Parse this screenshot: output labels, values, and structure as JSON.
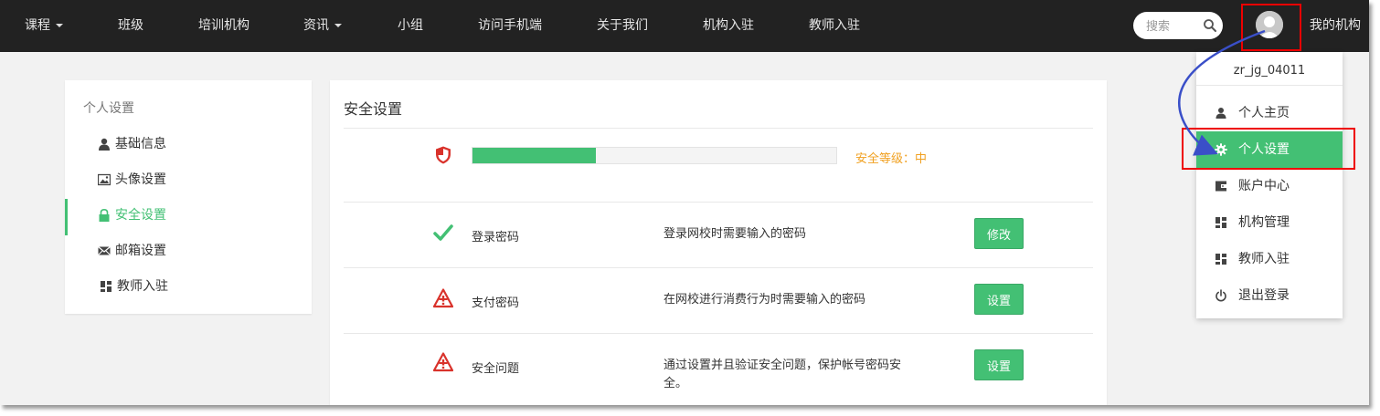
{
  "nav": {
    "items": [
      {
        "label": "课程",
        "dropdown": true
      },
      {
        "label": "班级",
        "dropdown": false
      },
      {
        "label": "培训机构",
        "dropdown": false
      },
      {
        "label": "资讯",
        "dropdown": true
      },
      {
        "label": "小组",
        "dropdown": false
      },
      {
        "label": "访问手机端",
        "dropdown": false
      },
      {
        "label": "关于我们",
        "dropdown": false
      },
      {
        "label": "机构入驻",
        "dropdown": false
      },
      {
        "label": "教师入驻",
        "dropdown": false
      }
    ],
    "search_placeholder": "搜索",
    "my_org": "我的机构",
    "bg_color": "#222222"
  },
  "sidebar": {
    "title": "个人设置",
    "items": [
      {
        "label": "基础信息",
        "icon": "user-icon",
        "active": false
      },
      {
        "label": "头像设置",
        "icon": "image-icon",
        "active": false
      },
      {
        "label": "安全设置",
        "icon": "lock-icon",
        "active": true
      },
      {
        "label": "邮箱设置",
        "icon": "envelope-icon",
        "active": false
      },
      {
        "label": "教师入驻",
        "icon": "dashboard-icon",
        "active": false
      }
    ]
  },
  "security": {
    "title": "安全设置",
    "level_percent": 34,
    "level_text": "安全等级：中",
    "rows": [
      {
        "name": "登录密码",
        "desc": "登录网校时需要输入的密码",
        "button": "修改",
        "status": "ok"
      },
      {
        "name": "支付密码",
        "desc": "在网校进行消费行为时需要输入的密码",
        "button": "设置",
        "status": "warning"
      },
      {
        "name": "安全问题",
        "desc": "通过设置并且验证安全问题，保护帐号密码安全。",
        "button": "设置",
        "status": "warning"
      }
    ]
  },
  "dropdown": {
    "username": "zr_jg_04011",
    "items": [
      {
        "label": "个人主页",
        "icon": "user-icon",
        "active": false
      },
      {
        "label": "个人设置",
        "icon": "gear-icon",
        "active": true
      },
      {
        "label": "账户中心",
        "icon": "wallet-icon",
        "active": false
      },
      {
        "label": "机构管理",
        "icon": "dashboard-icon",
        "active": false
      },
      {
        "label": "教师入驻",
        "icon": "dashboard-icon",
        "active": false
      },
      {
        "label": "退出登录",
        "icon": "power-icon",
        "active": false
      }
    ]
  },
  "colors": {
    "accent": "#43c074",
    "warning": "#f0a020",
    "danger": "#d9322b",
    "annotation": "#e00000",
    "arrow": "#3a4fc8"
  }
}
